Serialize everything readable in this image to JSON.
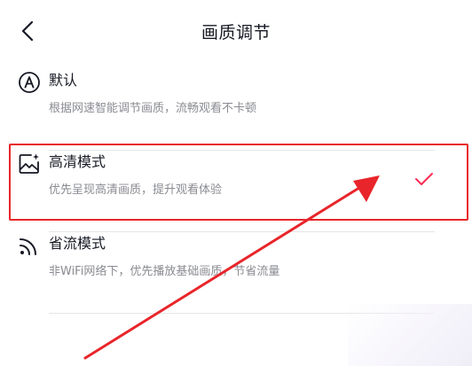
{
  "header": {
    "title": "画质调节",
    "back_icon": "chevron-left-icon"
  },
  "options": [
    {
      "label": "默认",
      "description": "根据网速智能调节画质，流畅观看不卡顿",
      "icon": "auto-a-icon",
      "selected": false
    },
    {
      "label": "高清模式",
      "description": "优先呈现高清画质，提升观看体验",
      "icon": "hd-image-icon",
      "selected": true
    },
    {
      "label": "省流模式",
      "description": "非WiFi网络下，优先播放基础画质，节省流量",
      "icon": "signal-icon",
      "selected": false
    }
  ],
  "colors": {
    "accent": "#fe2c55",
    "annotation": "#e8252a",
    "text_primary": "#161823",
    "text_secondary": "#8a8b91"
  }
}
